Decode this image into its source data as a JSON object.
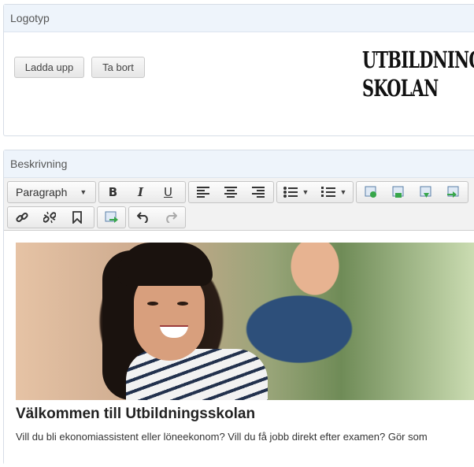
{
  "logo_panel": {
    "title": "Logotyp",
    "upload_label": "Ladda upp",
    "remove_label": "Ta bort",
    "logo_line1": "UTBILDNING",
    "logo_line2": "SKOLAN"
  },
  "description_panel": {
    "title": "Beskrivning",
    "format_select": "Paragraph",
    "heading": "Välkommen till Utbildningsskolan",
    "paragraph": "Vill du bli ekonomiassistent eller löneekonom? Vill du få jobb direkt efter examen? Gör som"
  },
  "toolbar_icons": [
    "bold-icon",
    "italic-icon",
    "underline-icon",
    "align-left-icon",
    "align-center-icon",
    "align-right-icon",
    "bullet-list-icon",
    "numbered-list-icon",
    "insert-image-icon",
    "insert-media-icon",
    "insert-file-icon",
    "insert-template-icon",
    "link-icon",
    "unlink-icon",
    "bookmark-icon",
    "image-manager-icon",
    "undo-icon",
    "redo-icon"
  ]
}
